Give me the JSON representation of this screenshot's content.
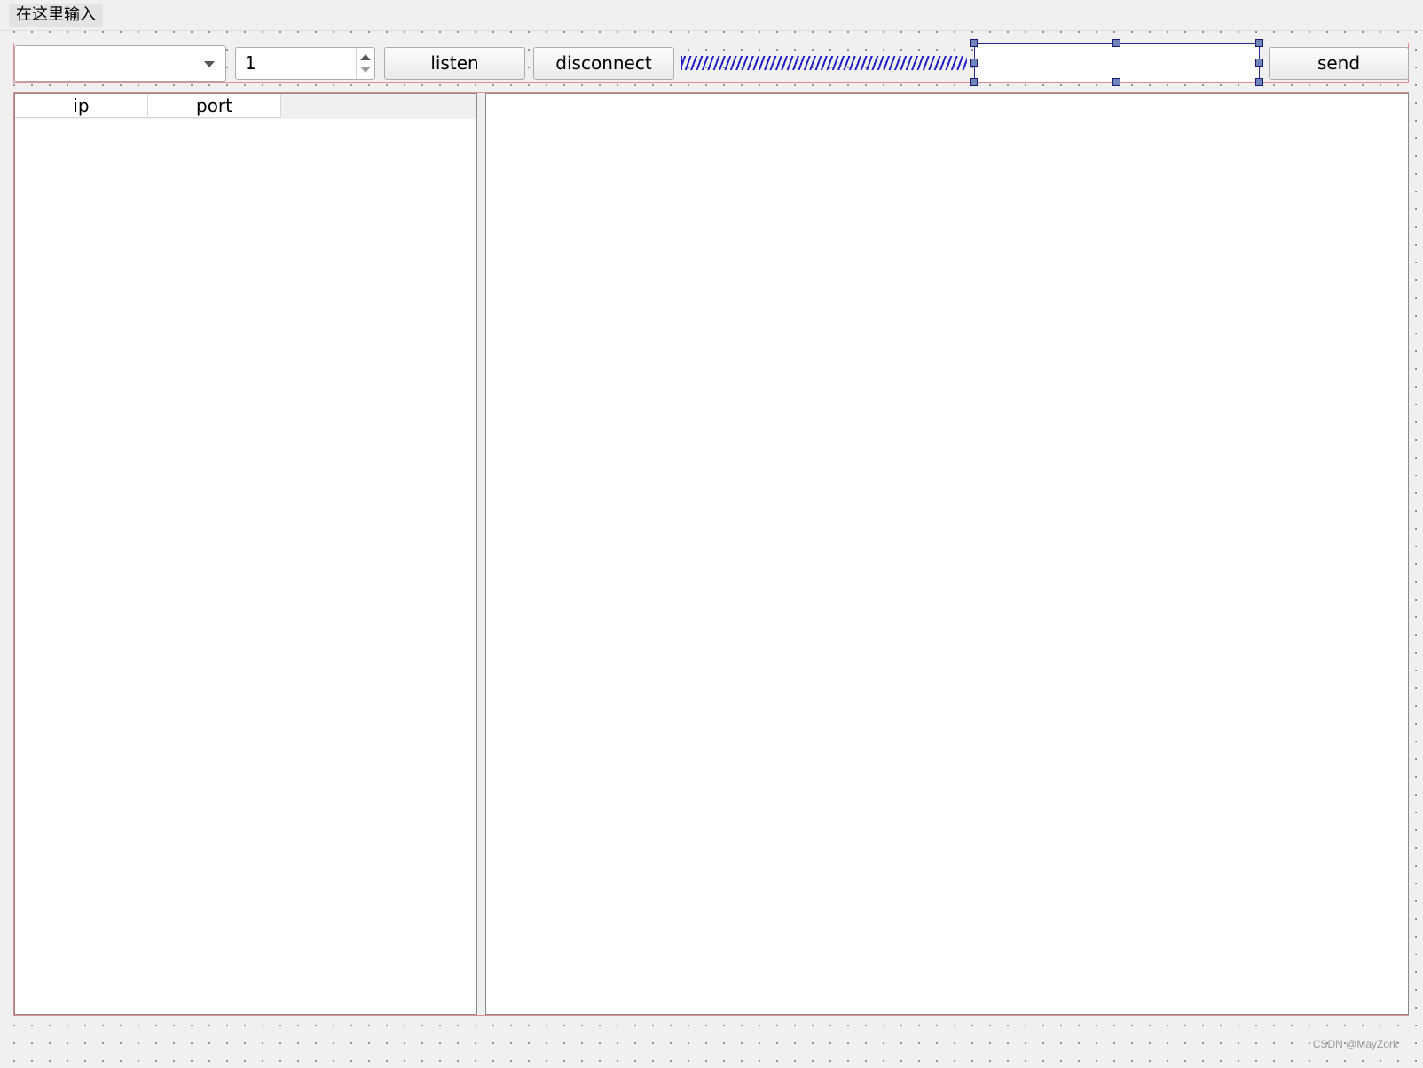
{
  "menu": {
    "placeholder": "在这里输入"
  },
  "toolbar": {
    "combo_value": "",
    "spin_value": "1",
    "listen_label": "listen",
    "disconnect_label": "disconnect",
    "send_input_value": "",
    "send_label": "send"
  },
  "table": {
    "columns": [
      "ip",
      "port"
    ],
    "rows": []
  },
  "log": {
    "text": ""
  },
  "watermark": "CSDN @MayZork",
  "colors": {
    "layout_border": "#e58a8a",
    "selection_handle": "#6f84b8",
    "spacer": "#2020c8"
  }
}
